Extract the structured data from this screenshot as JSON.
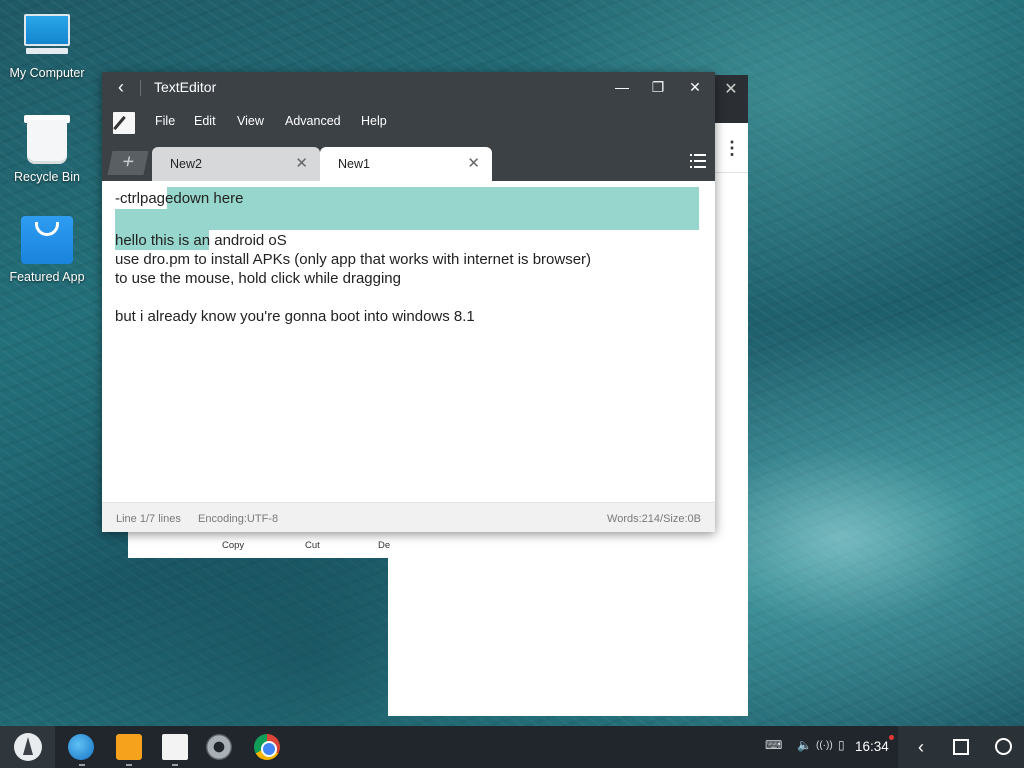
{
  "desktop": {
    "icons": [
      {
        "label": "My Computer",
        "icon": "computer-icon"
      },
      {
        "label": "Recycle Bin",
        "icon": "recycle-bin-icon"
      },
      {
        "label": "Featured App",
        "icon": "shopping-bag-icon"
      }
    ]
  },
  "background_window": {
    "close_glyph": "✕",
    "menu_glyph": "⋮",
    "context_menu": {
      "copy": "Copy",
      "cut": "Cut",
      "partial": "De"
    }
  },
  "editor": {
    "title": "TextEditor",
    "back_glyph": "‹",
    "window_buttons": {
      "minimize": "—",
      "maximize": "❐",
      "close": "✕"
    },
    "menu": [
      "File",
      "Edit",
      "View",
      "Advanced",
      "Help"
    ],
    "tabs": [
      {
        "label": "New2",
        "active": false
      },
      {
        "label": "New1",
        "active": true
      }
    ],
    "add_tab_glyph": "+",
    "tab_close_glyph": "✕",
    "lines": [
      "-ctrlpagedown here",
      "",
      "hello this is an android oS",
      "use dro.pm to install APKs (only app that works with internet is browser)",
      "to use the mouse, hold click while dragging",
      "",
      "but i already know you're gonna boot into windows 8.1"
    ],
    "selection_color": "#97d6cc",
    "status": {
      "line": "Line 1/7 lines",
      "encoding": "Encoding:UTF-8",
      "words": "Words:214/Size:0B"
    }
  },
  "taskbar": {
    "apps": [
      "browser-globe-icon",
      "file-manager-icon",
      "text-editor-icon",
      "settings-icon",
      "chrome-icon"
    ],
    "tray": {
      "keyboard": "⌨",
      "volume": "🔈",
      "signal": "((·))",
      "battery": "▯"
    },
    "clock": "16:34",
    "nav": {
      "back": "‹"
    }
  }
}
